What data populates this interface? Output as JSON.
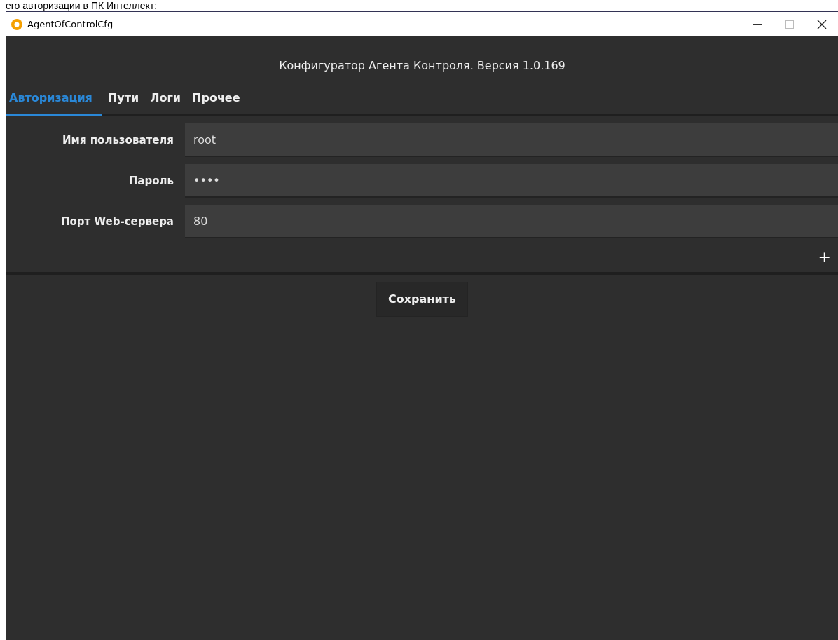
{
  "document_text": "его авторизации в ПК Интеллект:",
  "window": {
    "title": "AgentOfControlCfg"
  },
  "header": "Конфигуратор Агента Контроля. Версия 1.0.169",
  "tabs": [
    {
      "label": "Авторизация",
      "selected": true
    },
    {
      "label": "Пути",
      "selected": false
    },
    {
      "label": "Логи",
      "selected": false
    },
    {
      "label": "Прочее",
      "selected": false
    }
  ],
  "fields": [
    {
      "label": "Имя пользователя",
      "value": "root"
    },
    {
      "label": "Пароль",
      "value": "••••"
    },
    {
      "label": "Порт Web-сервера",
      "value": "80"
    }
  ],
  "add_button": "+",
  "save_button": "Сохранить"
}
